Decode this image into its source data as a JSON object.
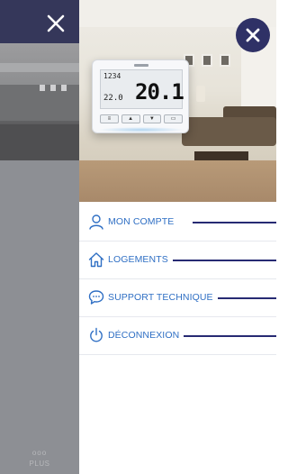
{
  "background_app": {
    "more_label": "PLUS",
    "more_dots": "ooo"
  },
  "thermostat": {
    "small_top": "1234",
    "small_mid": "22.0",
    "temperature": "20.1"
  },
  "menu": {
    "items": [
      {
        "label": "MON COMPTE",
        "icon": "user-icon"
      },
      {
        "label": "LOGEMENTS",
        "icon": "home-icon"
      },
      {
        "label": "SUPPORT TECHNIQUE",
        "icon": "chat-icon"
      },
      {
        "label": "DÉCONNEXION",
        "icon": "power-icon"
      }
    ]
  },
  "colors": {
    "accent_navy": "#272a73",
    "close_button": "#2f3166",
    "menu_text": "#2f6fc4",
    "header_bg": "#35375a",
    "overlay_gray": "#8d8f94"
  }
}
